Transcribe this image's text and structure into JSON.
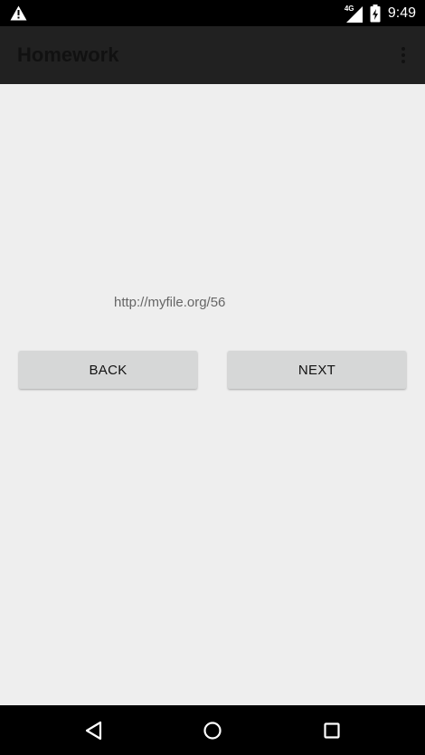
{
  "status_bar": {
    "network": "4G",
    "time": "9:49",
    "icons": [
      "warning-icon",
      "signal-icon",
      "battery-charging-icon"
    ]
  },
  "app_bar": {
    "title": "Homework",
    "overflow_icon": "more-vert-icon"
  },
  "main": {
    "url_text": "http://myfile.org/56",
    "back_label": "BACK",
    "next_label": "NEXT"
  },
  "nav_bar": {
    "icons": [
      "back-triangle-icon",
      "home-circle-icon",
      "recents-square-icon"
    ]
  },
  "colors": {
    "status_bar": "#000000",
    "app_bar": "#212121",
    "background": "#eeeeee",
    "button": "#d6d7d7",
    "url_text": "#666666"
  }
}
